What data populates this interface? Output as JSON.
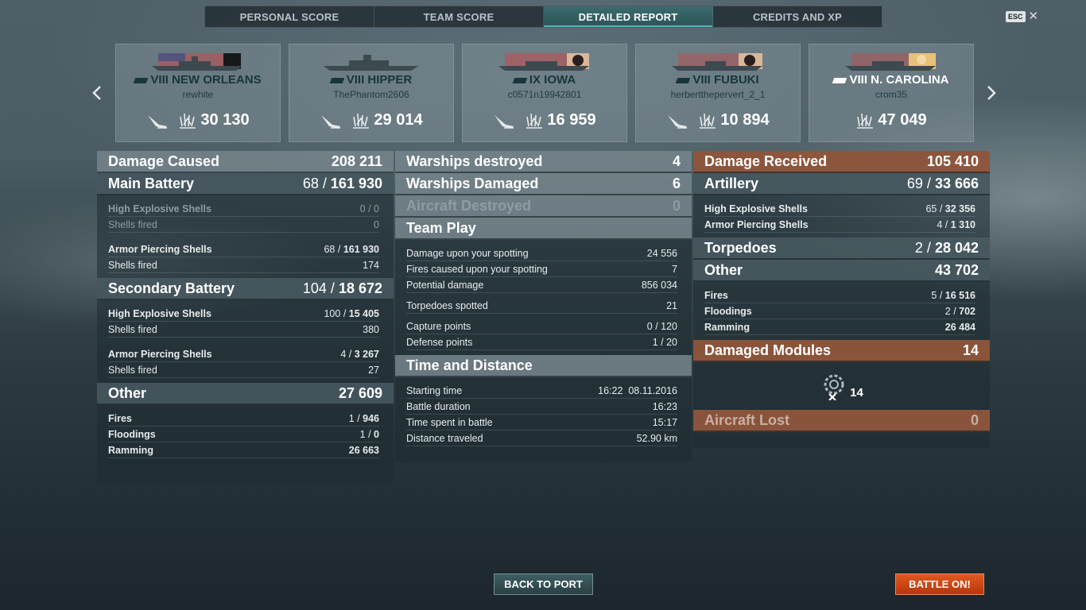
{
  "tabs": [
    {
      "label": "PERSONAL SCORE",
      "active": false
    },
    {
      "label": "TEAM SCORE",
      "active": false
    },
    {
      "label": "DETAILED REPORT",
      "active": true
    },
    {
      "label": "CREDITS AND XP",
      "active": false
    }
  ],
  "esc_label": "ESC",
  "ships": [
    {
      "name": "VIII NEW ORLEANS",
      "player": "rewhite",
      "damage": "30 130",
      "icon": "torpedo-hit-icon"
    },
    {
      "name": "VIII HIPPER",
      "player": "ThePhantom2606",
      "damage": "29 014",
      "icon": "torpedo-hit-icon"
    },
    {
      "name": "IX IOWA",
      "player": "c0571n19942801",
      "damage": "16 959",
      "icon": "torpedo-hit-icon"
    },
    {
      "name": "VIII FUBUKI",
      "player": "herbertthepervert_2_1",
      "damage": "10 894",
      "icon": "torpedo-hit-icon"
    },
    {
      "name": "VIII N. CAROLINA",
      "player": "crom35",
      "damage": "47 049",
      "icon": "explosion-icon"
    }
  ],
  "left": {
    "damage_caused": {
      "label": "Damage Caused",
      "value": "208 211"
    },
    "main_battery": {
      "label": "Main Battery",
      "hits": "68",
      "sep": " / ",
      "total": "161 930"
    },
    "mb_he": {
      "label": "High Explosive Shells",
      "value": "0 / 0"
    },
    "mb_he_fired": {
      "label": "Shells fired",
      "value": "0"
    },
    "mb_ap": {
      "label": "Armor Piercing Shells",
      "hits": "68",
      "sep": " / ",
      "total": "161 930"
    },
    "mb_ap_fired": {
      "label": "Shells fired",
      "value": "174"
    },
    "secondary": {
      "label": "Secondary Battery",
      "hits": "104",
      "sep": " / ",
      "total": "18 672"
    },
    "sb_he": {
      "label": "High Explosive Shells",
      "hits": "100",
      "sep": " / ",
      "total": "15 405"
    },
    "sb_he_fired": {
      "label": "Shells fired",
      "value": "380"
    },
    "sb_ap": {
      "label": "Armor Piercing Shells",
      "hits": "4",
      "sep": " / ",
      "total": "3 267"
    },
    "sb_ap_fired": {
      "label": "Shells fired",
      "value": "27"
    },
    "other": {
      "label": "Other",
      "value": "27 609"
    },
    "fires": {
      "label": "Fires",
      "hits": "1",
      "sep": " / ",
      "total": "946"
    },
    "floodings": {
      "label": "Floodings",
      "hits": "1",
      "sep": " / ",
      "total": "0"
    },
    "ramming": {
      "label": "Ramming",
      "value": "26 663"
    }
  },
  "middle": {
    "destroyed": {
      "label": "Warships destroyed",
      "value": "4"
    },
    "damaged": {
      "label": "Warships Damaged",
      "value": "6"
    },
    "aircraft": {
      "label": "Aircraft Destroyed",
      "value": "0"
    },
    "team_play": {
      "label": "Team Play"
    },
    "spotting_damage": {
      "label": "Damage upon your spotting",
      "value": "24 556"
    },
    "spotting_fires": {
      "label": "Fires caused upon your spotting",
      "value": "7"
    },
    "potential": {
      "label": "Potential damage",
      "value": "856 034"
    },
    "torps_spotted": {
      "label": "Torpedoes spotted",
      "value": "21"
    },
    "capture": {
      "label": "Capture points",
      "value": "0 / 120"
    },
    "defense": {
      "label": "Defense points",
      "value": "1 / 20"
    },
    "time_distance": {
      "label": "Time and Distance"
    },
    "start": {
      "label": "Starting time",
      "value": "16:22  08.11.2016"
    },
    "duration": {
      "label": "Battle duration",
      "value": "16:23"
    },
    "time_spent": {
      "label": "Time spent in battle",
      "value": "15:17"
    },
    "distance": {
      "label": "Distance traveled",
      "value": "52.90 km"
    }
  },
  "right": {
    "received": {
      "label": "Damage Received",
      "value": "105 410"
    },
    "artillery": {
      "label": "Artillery",
      "hits": "69",
      "sep": " / ",
      "total": "33 666"
    },
    "art_he": {
      "label": "High Explosive Shells",
      "hits": "65",
      "sep": " / ",
      "total": "32 356"
    },
    "art_ap": {
      "label": "Armor Piercing Shells",
      "hits": "4",
      "sep": " / ",
      "total": "1 310"
    },
    "torpedoes": {
      "label": "Torpedoes",
      "hits": "2",
      "sep": " / ",
      "total": "28 042"
    },
    "other": {
      "label": "Other",
      "value": "43 702"
    },
    "fires": {
      "label": "Fires",
      "hits": "5",
      "sep": " / ",
      "total": "16 516"
    },
    "floodings": {
      "label": "Floodings",
      "hits": "2",
      "sep": " / ",
      "total": "702"
    },
    "ramming": {
      "label": "Ramming",
      "value": "26 484"
    },
    "modules": {
      "label": "Damaged Modules",
      "value": "14"
    },
    "modules_count": "14",
    "aircraft_lost": {
      "label": "Aircraft Lost",
      "value": "0"
    }
  },
  "buttons": {
    "back": "BACK TO PORT",
    "battle": "BATTLE ON!"
  },
  "colors": {
    "accent": "#4fb7b3",
    "battle": "#d4481a",
    "received_header": "#96583c"
  }
}
